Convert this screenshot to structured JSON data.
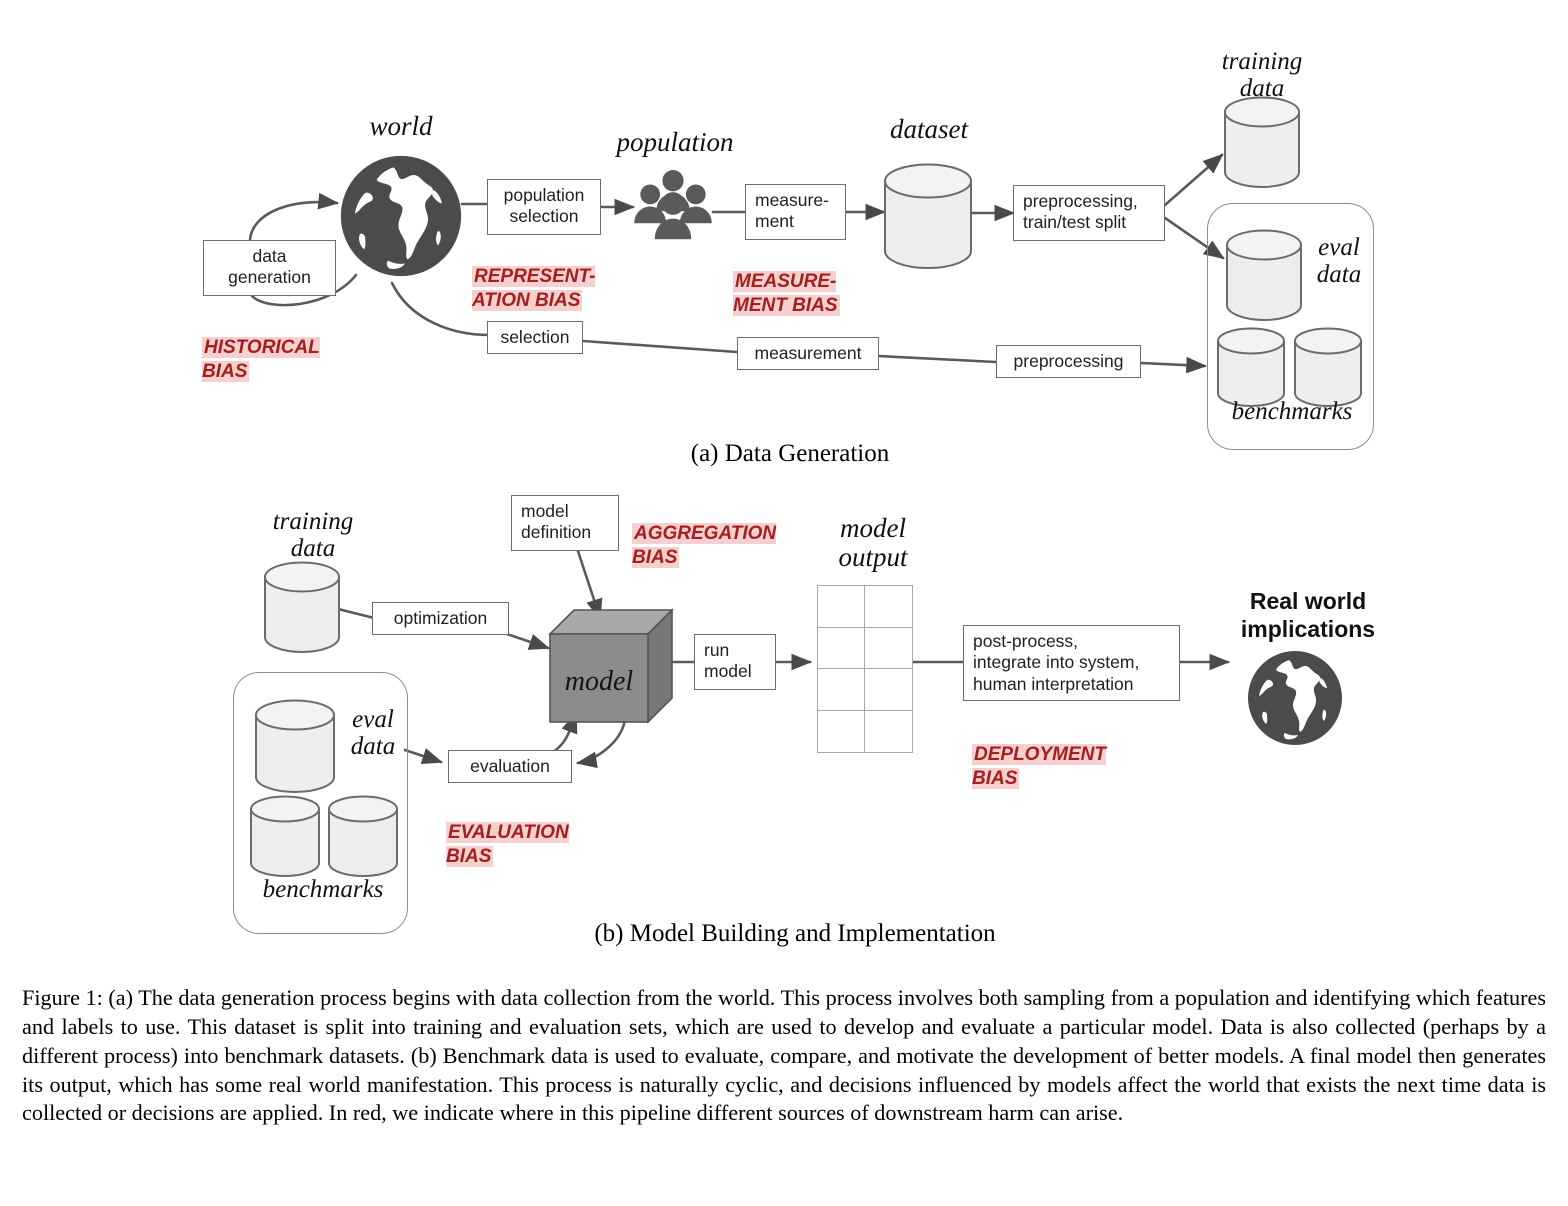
{
  "figure": {
    "caption": "Figure 1: (a) The data generation process begins with data collection from the world. This process involves both sampling from a population and identifying which features and labels to use. This dataset is split into training and evaluation sets, which are used to develop and evaluate a particular model. Data is also collected (perhaps by a different process) into benchmark datasets. (b) Benchmark data is used to evaluate, compare, and motivate the development of better models. A final model then generates its output, which has some real world manifestation. This process is naturally cyclic, and decisions influenced by models affect the world that exists the next time data is collected or decisions are applied. In red, we indicate where in this pipeline different sources of downstream harm can arise.",
    "subcaption_a": "(a) Data Generation",
    "subcaption_b": "(b) Model Building and Implementation"
  },
  "colors": {
    "bias_text": "#a3201f",
    "bias_highlight": "#f6cfcf",
    "box_border": "#6d6d6d",
    "cylinder_fill": "#eeeeee",
    "cylinder_stroke": "#6b6b6b",
    "cube_front": "#8c8c8c",
    "cube_top": "#a9a9a9",
    "cube_side": "#777777",
    "icon_gray": "#4f4f4f",
    "arrow": "#4a4a4a"
  },
  "panel_a": {
    "entities": [
      {
        "id": "world",
        "label": "world",
        "type": "globe-icon"
      },
      {
        "id": "population",
        "label": "population",
        "type": "people-icon"
      },
      {
        "id": "dataset",
        "label": "dataset",
        "type": "cylinder"
      },
      {
        "id": "training_data",
        "label": "training\ndata",
        "type": "cylinder"
      },
      {
        "id": "eval_data",
        "label": "eval\ndata",
        "type": "cylinder"
      },
      {
        "id": "benchmarks",
        "label": "benchmarks",
        "type": "cylinder-pair"
      }
    ],
    "processes": [
      {
        "id": "data_generation",
        "label": "data\ngeneration"
      },
      {
        "id": "population_selection",
        "label": "population\nselection"
      },
      {
        "id": "measurement_top",
        "label": "measure-\nment"
      },
      {
        "id": "preprocessing_split",
        "label": "preprocessing,\ntrain/test split"
      },
      {
        "id": "selection",
        "label": "selection"
      },
      {
        "id": "measurement_bottom",
        "label": "measurement"
      },
      {
        "id": "preprocessing",
        "label": "preprocessing"
      }
    ],
    "biases": [
      {
        "id": "historical",
        "label": "HISTORICAL\nBIAS"
      },
      {
        "id": "representation",
        "label": "REPRESENT-\nATION  BIAS"
      },
      {
        "id": "measurement",
        "label": "MEASURE-\nMENT BIAS"
      }
    ]
  },
  "panel_b": {
    "entities": [
      {
        "id": "training_data",
        "label": "training\ndata",
        "type": "cylinder"
      },
      {
        "id": "eval_data",
        "label": "eval\ndata",
        "type": "cylinder"
      },
      {
        "id": "benchmarks",
        "label": "benchmarks",
        "type": "cylinder-pair"
      },
      {
        "id": "model",
        "label": "model",
        "type": "cube"
      },
      {
        "id": "model_output",
        "label": "model\noutput",
        "type": "grid",
        "rows": 4,
        "cols": 2
      },
      {
        "id": "real_world",
        "label": "Real world\nimplications",
        "type": "globe-icon"
      }
    ],
    "processes": [
      {
        "id": "model_definition",
        "label": "model\ndefinition"
      },
      {
        "id": "optimization",
        "label": "optimization"
      },
      {
        "id": "evaluation",
        "label": "evaluation"
      },
      {
        "id": "run_model",
        "label": "run\nmodel"
      },
      {
        "id": "post_process",
        "label": "post-process,\nintegrate into system,\nhuman interpretation"
      }
    ],
    "biases": [
      {
        "id": "aggregation",
        "label": "AGGREGATION\nBIAS"
      },
      {
        "id": "evaluation",
        "label": "EVALUATION\nBIAS"
      },
      {
        "id": "deployment",
        "label": "DEPLOYMENT\nBIAS"
      }
    ]
  }
}
